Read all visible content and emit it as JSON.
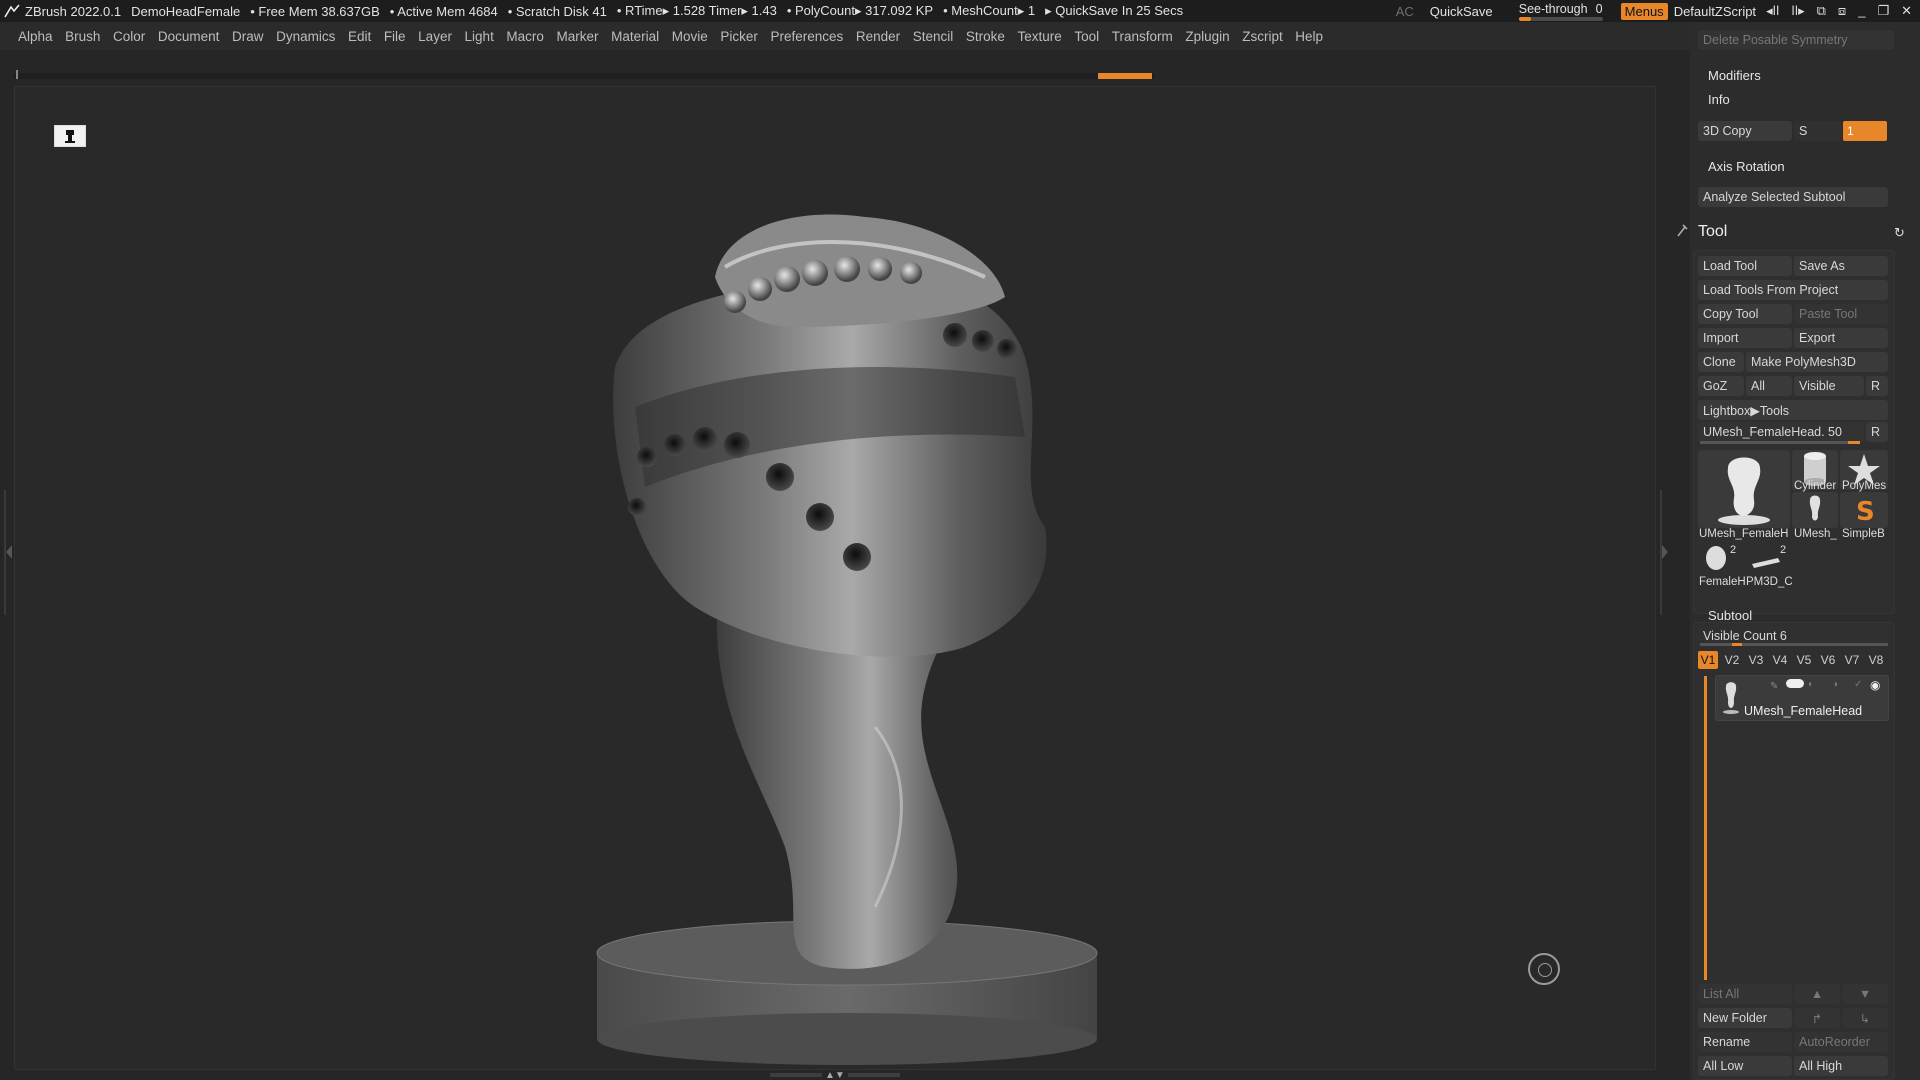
{
  "titlebar": {
    "app": "ZBrush 2022.0.1",
    "document": "DemoHeadFemale",
    "free_mem": "• Free Mem 38.637GB",
    "active_mem": "• Active Mem 4684",
    "scratch_disk": "• Scratch Disk 41",
    "rtime": "• RTime▸ 1.528 Timer▸ 1.43",
    "polycount": "• PolyCount▸ 317.092 KP",
    "meshcount": "• MeshCount▸ 1",
    "quicksave_info": "▸ QuickSave In 25 Secs",
    "ac": "AC",
    "quicksave": "QuickSave",
    "see_through_label": "See-through",
    "see_through_value": "0",
    "menus": "Menus",
    "script": "DefaultZScript"
  },
  "menu": [
    "Alpha",
    "Brush",
    "Color",
    "Document",
    "Draw",
    "Dynamics",
    "Edit",
    "File",
    "Layer",
    "Light",
    "Macro",
    "Marker",
    "Material",
    "Movie",
    "Picker",
    "Preferences",
    "Render",
    "Stencil",
    "Stroke",
    "Texture",
    "Tool",
    "Transform",
    "Zplugin",
    "Zscript",
    "Help"
  ],
  "panel": {
    "delete_posable_symmetry": "Delete Posable Symmetry",
    "modifiers": "Modifiers",
    "info": "Info",
    "copy3d": "3D Copy",
    "copy3d_s": "S",
    "copy3d_value": "1",
    "axis_rotation": "Axis Rotation",
    "analyze": "Analyze Selected Subtool",
    "tool_title": "Tool",
    "load_tool": "Load Tool",
    "save_as": "Save As",
    "load_tools_from_project": "Load Tools From Project",
    "copy_tool": "Copy Tool",
    "paste_tool": "Paste Tool",
    "import": "Import",
    "export": "Export",
    "clone": "Clone",
    "make_polymesh": "Make PolyMesh3D",
    "goz": "GoZ",
    "all": "All",
    "visible": "Visible",
    "r": "R",
    "lightbox_tools": "Lightbox▶Tools",
    "current_tool": "UMesh_FemaleHead. 50",
    "current_r": "R",
    "thumbs": {
      "main": "UMesh_FemaleH",
      "cylinder": "Cylinder",
      "polymesh": "PolyMes",
      "umesh_small": "UMesh_",
      "simpleb": "SimpleB",
      "female": "FemaleH",
      "female_count": "2",
      "pm3d": "PM3D_C",
      "pm3d_count": "2"
    },
    "subtool": "Subtool",
    "visible_count": "Visible Count 6",
    "v_buttons": [
      "V1",
      "V2",
      "V3",
      "V4",
      "V5",
      "V6",
      "V7",
      "V8"
    ],
    "subtool_item": "UMesh_FemaleHead",
    "list_all": "List All",
    "new_folder": "New Folder",
    "rename": "Rename",
    "autoreorder": "AutoReorder",
    "all_low": "All Low",
    "all_high": "All High"
  },
  "colors": {
    "accent": "#e8862a",
    "background": "#262626",
    "panel": "#2c2c2c"
  }
}
